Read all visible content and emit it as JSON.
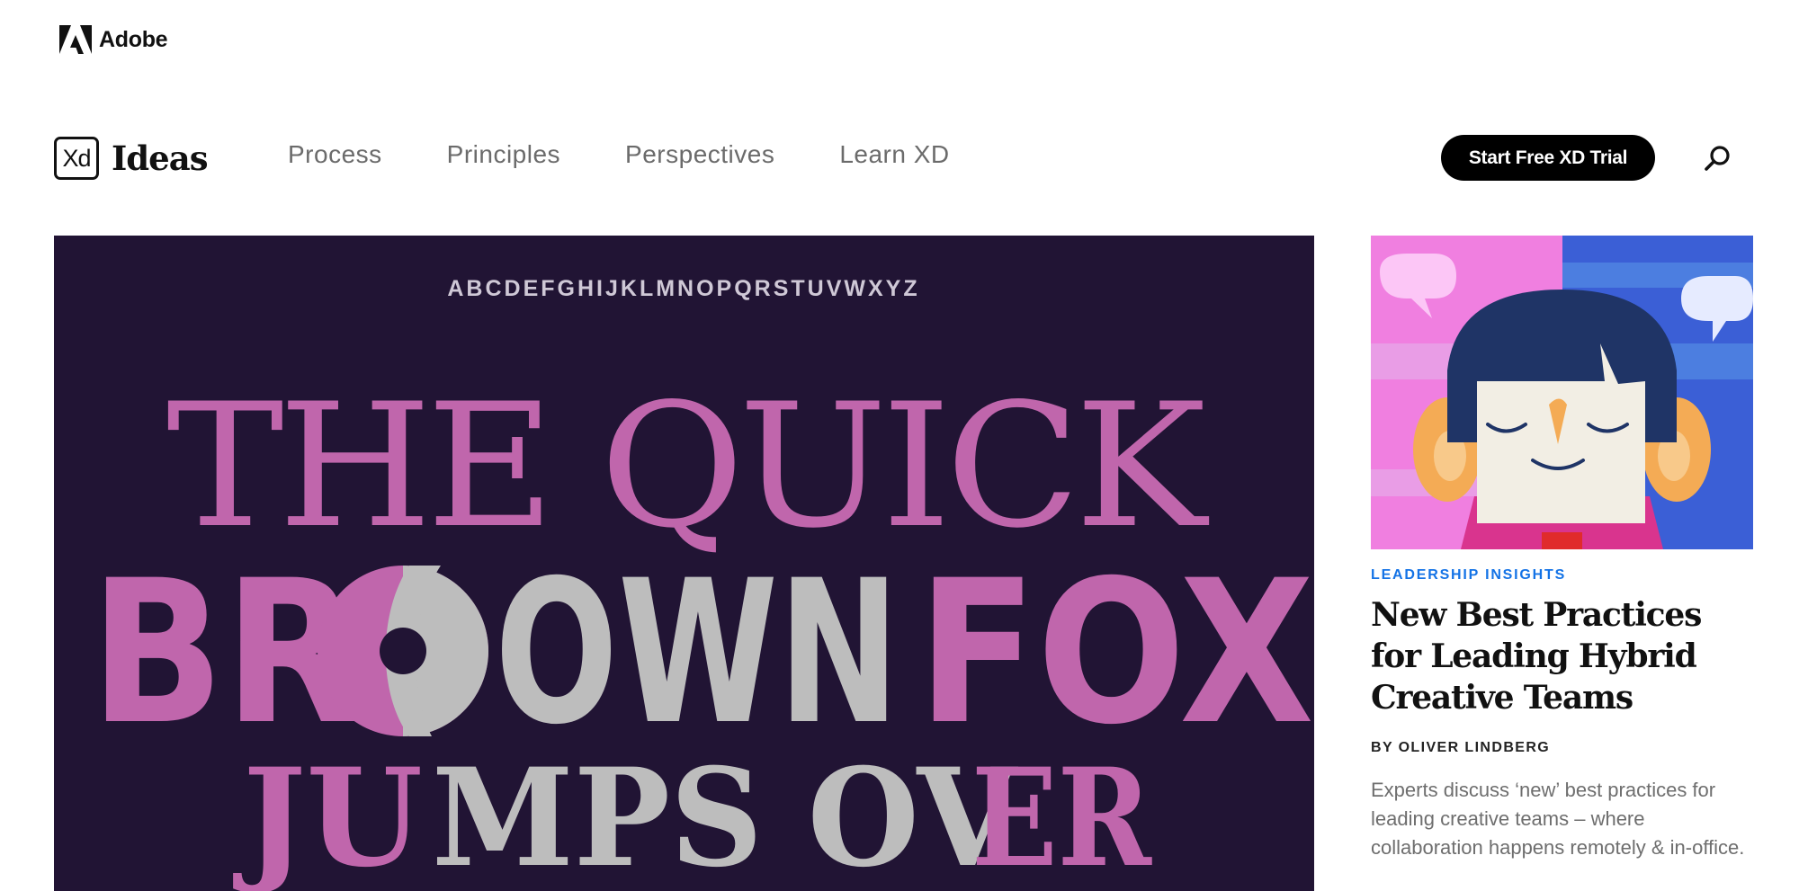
{
  "adobe": {
    "brand": "Adobe"
  },
  "nav": {
    "logo_box": "Xd",
    "logo_text": "Ideas",
    "links": [
      "Process",
      "Principles",
      "Perspectives",
      "Learn XD"
    ],
    "cta": "Start Free XD Trial"
  },
  "hero": {
    "alphabet": "ABCDEFGHIJKLMNOPQRSTUVWXYZ",
    "line1": "THE QUICK",
    "line2_a": "BR",
    "line2_b": "OWN",
    "line2_c": "FOX",
    "line3_a": "JU",
    "line3_b": "MPS OV",
    "line3_c": "ER",
    "colors": {
      "background": "#211434",
      "pink": "#c066ac",
      "gray": "#bdbdbd"
    }
  },
  "feature": {
    "category": "LEADERSHIP INSIGHTS",
    "headline": "New Best Practices for Leading Hybrid Creative Teams",
    "byline": "BY OLIVER LINDBERG",
    "excerpt": "Experts discuss ‘new’ best practices for leading creative teams – where collaboration happens remotely & in-office."
  },
  "colors": {
    "accent": "#1473e6",
    "text": "#111111"
  }
}
